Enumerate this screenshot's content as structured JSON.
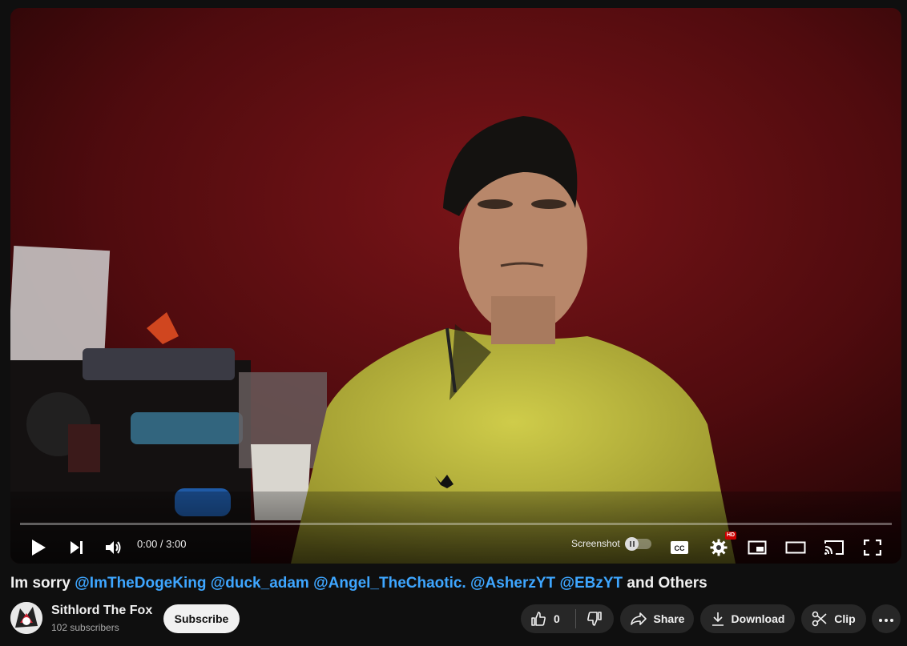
{
  "player": {
    "current_time": "0:00",
    "duration": "3:00",
    "time_display": "0:00 / 3:00",
    "progress_fraction": 0.0,
    "screenshot_label": "Screenshot",
    "hd_badge": "HD",
    "icons": [
      "play-icon",
      "next-icon",
      "volume-icon",
      "cc-icon",
      "settings-icon",
      "miniplayer-icon",
      "theater-icon",
      "cast-icon",
      "fullscreen-icon"
    ]
  },
  "video": {
    "title_prefix": "Im sorry ",
    "mentions": [
      "@ImTheDogeKing",
      "@duck_adam",
      "@Angel_TheChaotic.",
      "@AsherzYT",
      "@EBzYT"
    ],
    "title_suffix": " and Others"
  },
  "channel": {
    "name": "Sithlord The Fox",
    "subscribers": "102 subscribers",
    "subscribe_label": "Subscribe"
  },
  "actions": {
    "like_count": "0",
    "share_label": "Share",
    "download_label": "Download",
    "clip_label": "Clip"
  },
  "colors": {
    "background": "#0f0f0f",
    "mention": "#3ea6ff",
    "pill": "#272727",
    "progress": "#ff0033"
  }
}
